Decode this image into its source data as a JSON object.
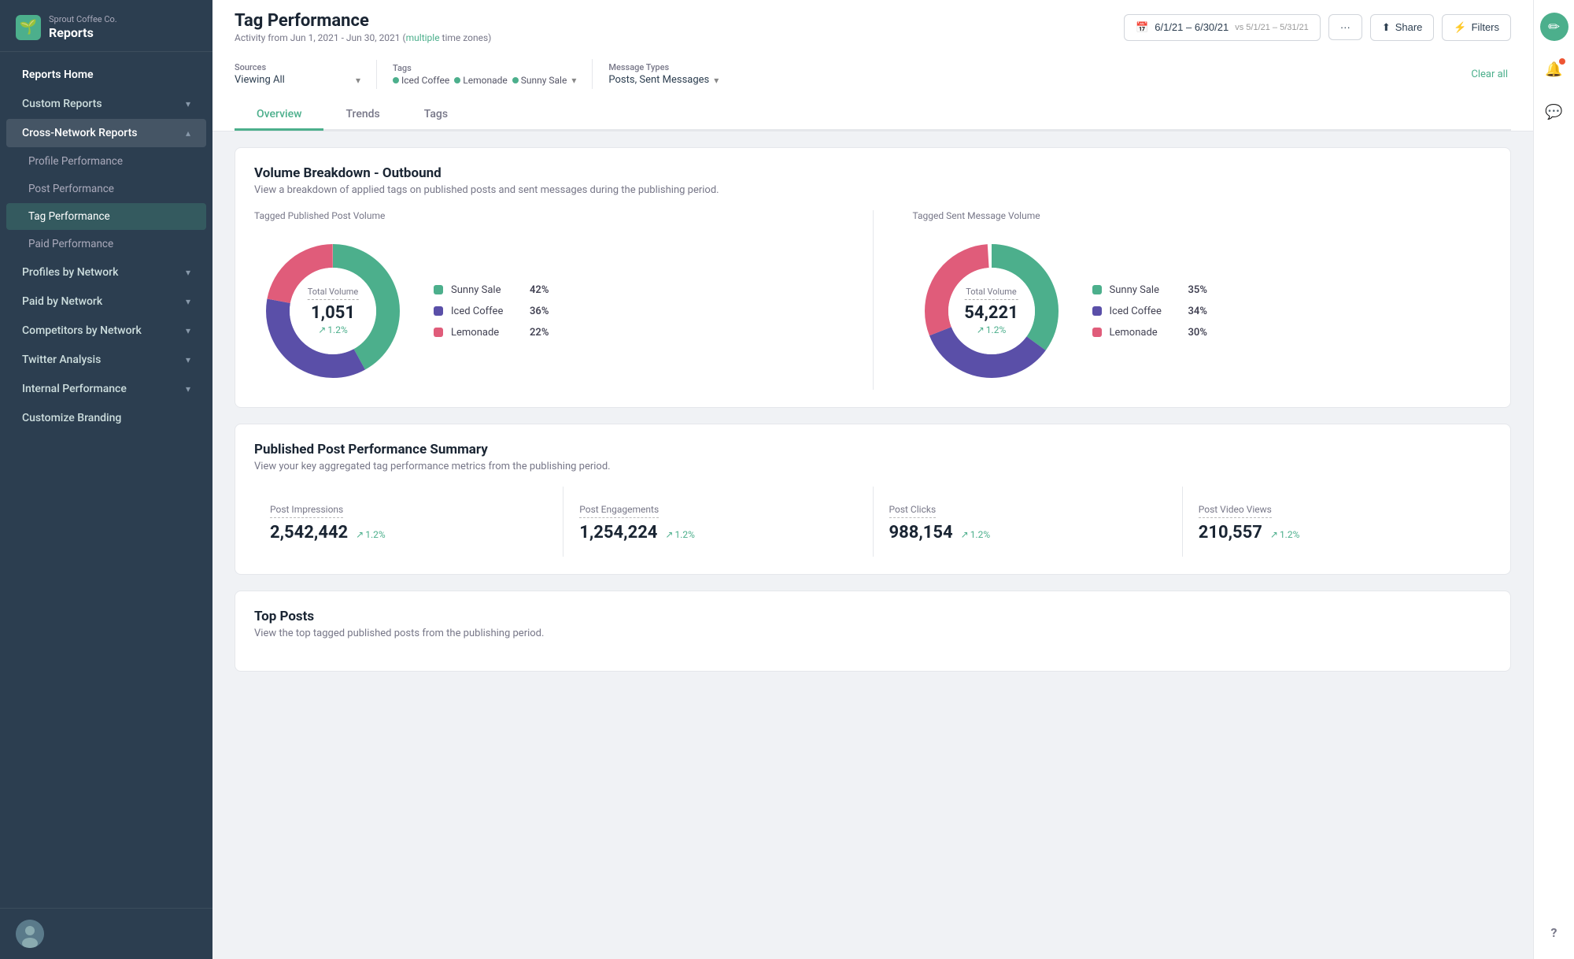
{
  "company": {
    "name": "Sprout Coffee Co.",
    "section": "Reports"
  },
  "sidebar": {
    "nav": [
      {
        "id": "reports-home",
        "label": "Reports Home",
        "type": "top"
      },
      {
        "id": "custom-reports",
        "label": "Custom Reports",
        "type": "expandable",
        "expanded": false
      },
      {
        "id": "cross-network",
        "label": "Cross-Network Reports",
        "type": "expandable",
        "expanded": true
      },
      {
        "id": "profile-performance",
        "label": "Profile Performance",
        "type": "sub"
      },
      {
        "id": "post-performance",
        "label": "Post Performance",
        "type": "sub"
      },
      {
        "id": "tag-performance",
        "label": "Tag Performance",
        "type": "sub",
        "active": true
      },
      {
        "id": "paid-performance",
        "label": "Paid Performance",
        "type": "sub"
      },
      {
        "id": "profiles-by-network",
        "label": "Profiles by Network",
        "type": "expandable"
      },
      {
        "id": "paid-by-network",
        "label": "Paid by Network",
        "type": "expandable"
      },
      {
        "id": "competitors-by-network",
        "label": "Competitors by Network",
        "type": "expandable"
      },
      {
        "id": "twitter-analysis",
        "label": "Twitter Analysis",
        "type": "expandable"
      },
      {
        "id": "internal-performance",
        "label": "Internal Performance",
        "type": "expandable"
      },
      {
        "id": "customize-branding",
        "label": "Customize Branding",
        "type": "top"
      }
    ]
  },
  "header": {
    "page_title": "Tag Performance",
    "activity_label": "Activity from Jun 1, 2021 - Jun 30, 2021",
    "multiple_label": "multiple",
    "timezone_label": "time zones",
    "date_range": "6/1/21 – 6/30/21",
    "vs_label": "vs 5/1/21 – 5/31/21",
    "more_btn": "···",
    "share_btn": "Share",
    "filters_btn": "Filters"
  },
  "filters": {
    "sources_label": "Sources",
    "sources_value": "Viewing All",
    "tags_label": "Tags",
    "tags": [
      {
        "name": "Iced Coffee",
        "color": "#4caf8c"
      },
      {
        "name": "Lemonade",
        "color": "#4caf8c"
      },
      {
        "name": "Sunny Sale",
        "color": "#4caf8c"
      }
    ],
    "message_types_label": "Message Types",
    "message_types_value": "Posts, Sent Messages",
    "clear_all": "Clear all"
  },
  "tabs": [
    {
      "id": "overview",
      "label": "Overview",
      "active": true
    },
    {
      "id": "trends",
      "label": "Trends"
    },
    {
      "id": "tags",
      "label": "Tags"
    }
  ],
  "volume_section": {
    "title": "Volume Breakdown - Outbound",
    "desc": "View a breakdown of applied tags on published posts and sent messages during the publishing period.",
    "left_chart": {
      "label": "Tagged Published Post Volume",
      "center_label": "Total Volume",
      "center_value": "1,051",
      "trend": "1.2%",
      "segments": [
        {
          "name": "Sunny Sale",
          "pct": 42,
          "color": "#4caf8c"
        },
        {
          "name": "Iced Coffee",
          "pct": 36,
          "color": "#5a4fa8"
        },
        {
          "name": "Lemonade",
          "pct": 22,
          "color": "#e05c7a"
        }
      ]
    },
    "right_chart": {
      "label": "Tagged Sent Message Volume",
      "center_label": "Total Volume",
      "center_value": "54,221",
      "trend": "1.2%",
      "segments": [
        {
          "name": "Sunny Sale",
          "pct": 35,
          "color": "#4caf8c"
        },
        {
          "name": "Iced Coffee",
          "pct": 34,
          "color": "#5a4fa8"
        },
        {
          "name": "Lemonade",
          "pct": 30,
          "color": "#e05c7a"
        }
      ]
    }
  },
  "post_performance_section": {
    "title": "Published Post Performance Summary",
    "desc": "View your key aggregated tag performance metrics from the publishing period.",
    "stats": [
      {
        "name": "Post Impressions",
        "value": "2,542,442",
        "trend": "1.2%"
      },
      {
        "name": "Post Engagements",
        "value": "1,254,224",
        "trend": "1.2%"
      },
      {
        "name": "Post Clicks",
        "value": "988,154",
        "trend": "1.2%"
      },
      {
        "name": "Post Video Views",
        "value": "210,557",
        "trend": "1.2%"
      }
    ]
  },
  "top_posts_section": {
    "title": "Top Posts",
    "desc": "View the top tagged published posts from the publishing period."
  },
  "icons": {
    "logo": "🌱",
    "calendar": "📅",
    "share": "⬆",
    "filter": "⚡",
    "chevron_down": "▾",
    "arrow_up": "↗",
    "edit": "✏",
    "bell": "🔔",
    "comment": "💬",
    "help": "?"
  }
}
